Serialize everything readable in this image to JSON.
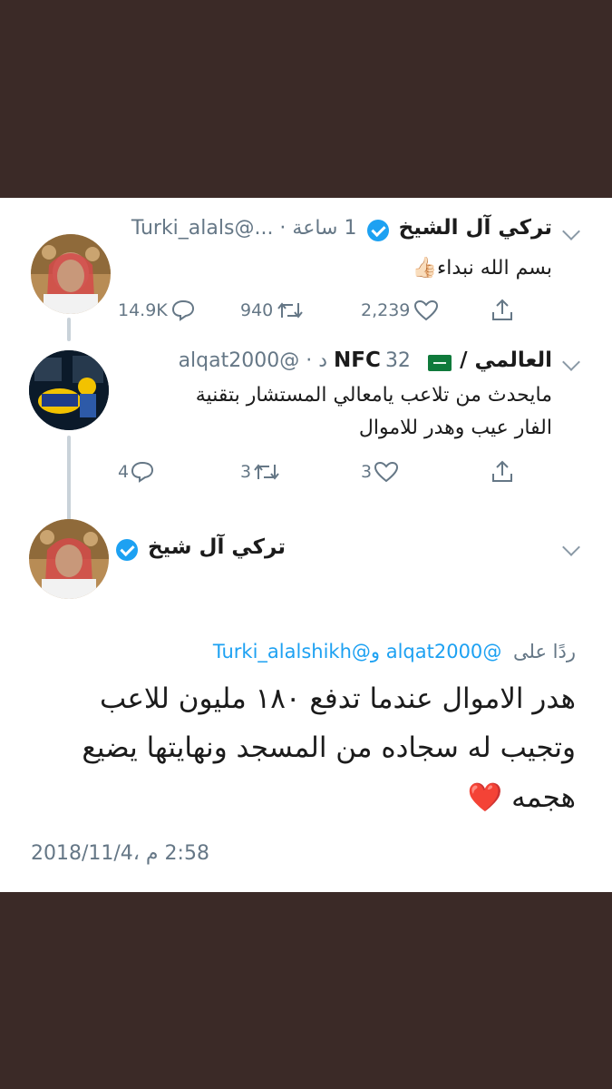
{
  "tweet1": {
    "name": "تركي آل الشيخ",
    "meta": "1 ساعة · ...@Turki_alals",
    "text": "بسم الله نبداء👍🏻",
    "replies": "14.9K",
    "retweets": "940",
    "likes": "2,239"
  },
  "tweet2": {
    "name_ar": "العالمي /",
    "name_tag": "NFC",
    "meta": "32 د · @alqat2000",
    "text_line1": "مايحدث من تلاعب يامعالي المستشار بتقنية",
    "text_line2": "الفار عيب وهدر للاموال",
    "replies": "4",
    "retweets": "3",
    "likes": "3"
  },
  "tweet3": {
    "name": "تركي آل شيخ",
    "reply_prefix": "ردًا على",
    "reply_mentions": "@alqat2000 و@Turki_alalshikh",
    "text_line1": "هدر الاموال عندما تدفع ١٨٠ مليون للاعب",
    "text_line2": "وتجيب له سجاده من المسجد ونهايتها يضيع",
    "text_line3": "هجمه ❤️",
    "timestamp": "2:58 م ،2018/11/4"
  },
  "icons": [
    "reply-icon",
    "retweet-icon",
    "like-icon",
    "share-icon",
    "verified-icon",
    "chevron-down-icon",
    "saudi-flag-icon"
  ],
  "colors": {
    "background": "#3b2a27",
    "card": "#ffffff",
    "verified": "#1da1f2",
    "heart": "#e0245e",
    "meta": "#657786"
  }
}
